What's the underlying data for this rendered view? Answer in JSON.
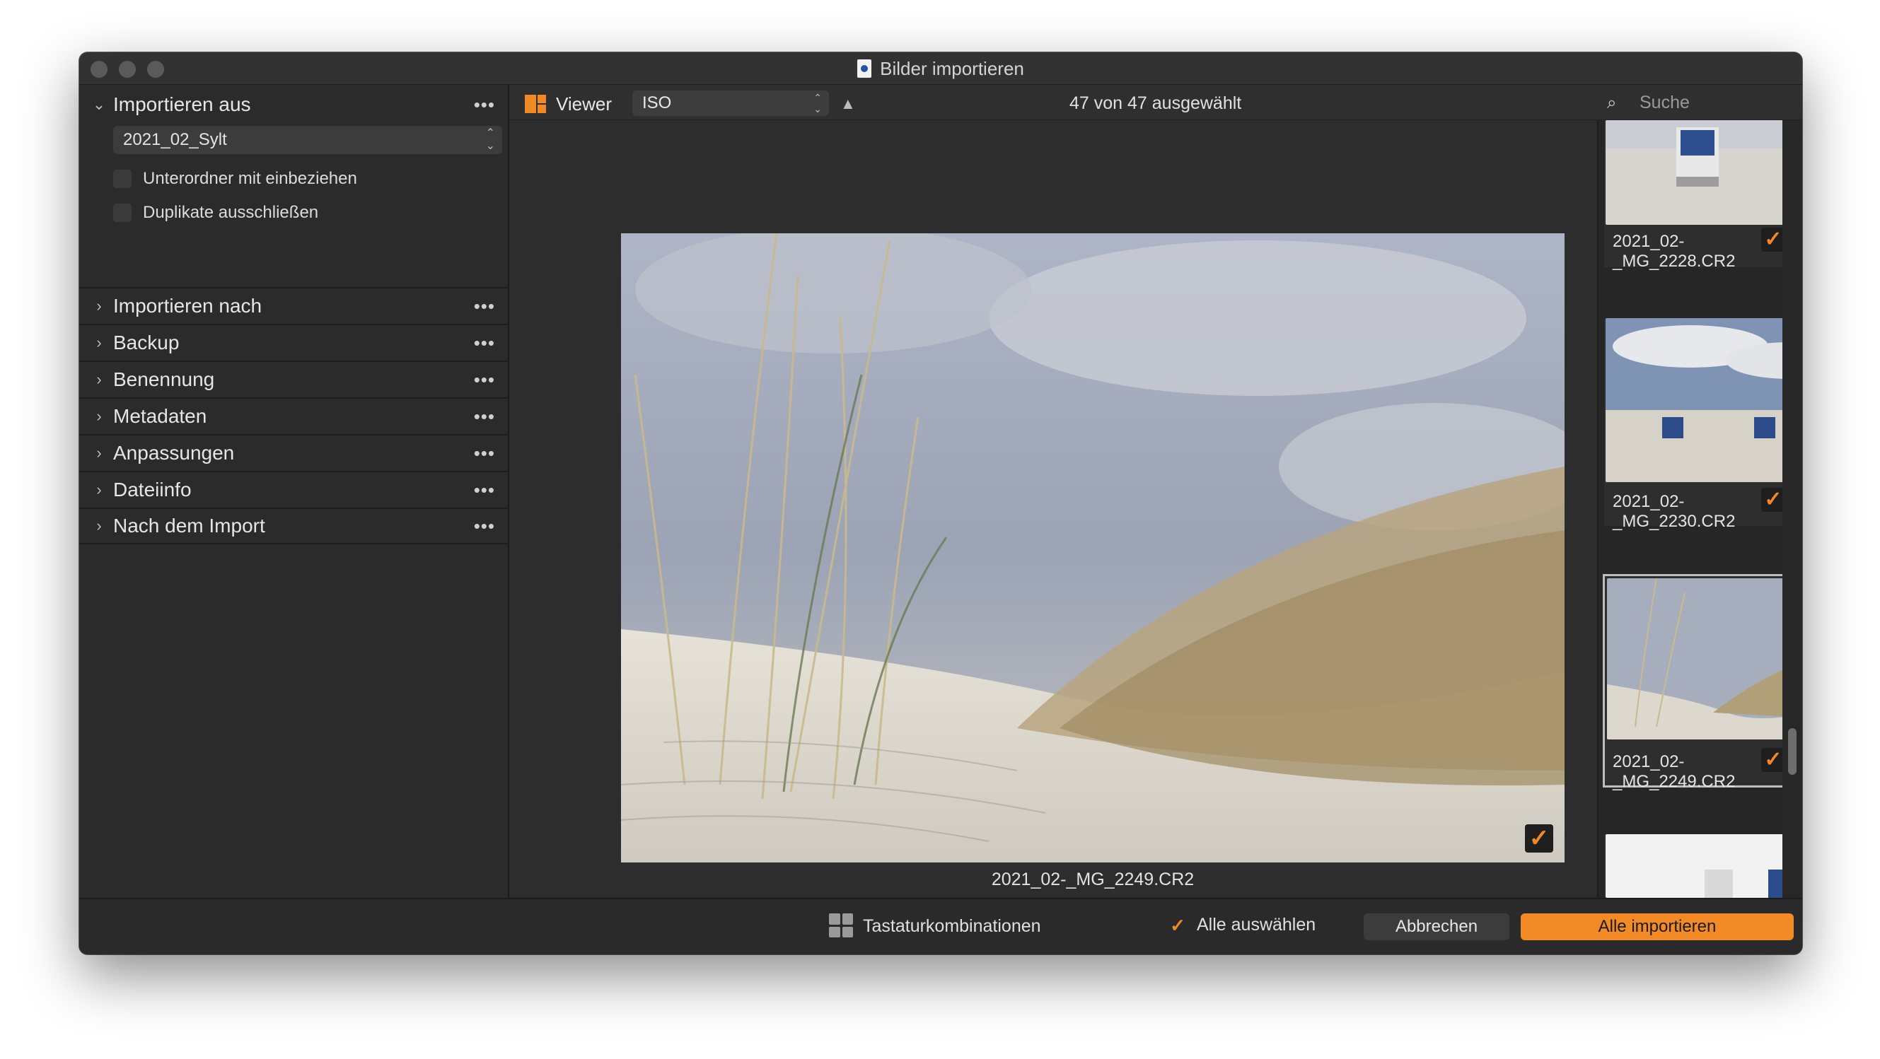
{
  "window": {
    "title": "Bilder importieren"
  },
  "left_panel": {
    "import_from": {
      "label": "Importieren aus",
      "folder": "2021_02_Sylt",
      "options": [
        {
          "label": "Unterordner mit einbeziehen",
          "checked": false
        },
        {
          "label": "Duplikate ausschließen",
          "checked": false
        }
      ]
    },
    "sections": [
      {
        "label": "Importieren nach"
      },
      {
        "label": "Backup"
      },
      {
        "label": "Benennung"
      },
      {
        "label": "Metadaten"
      },
      {
        "label": "Anpassungen"
      },
      {
        "label": "Dateiinfo"
      },
      {
        "label": "Nach dem Import"
      }
    ]
  },
  "toolbar": {
    "viewer_label": "Viewer",
    "sort_value": "ISO",
    "selection_count": "47 von 47 ausgewählt",
    "search_placeholder": "Suche"
  },
  "viewer": {
    "caption": "2021_02-_MG_2249.CR2",
    "selected": true
  },
  "thumbnails": [
    {
      "name": "2021_02-_MG_2228.CR2",
      "checked": true
    },
    {
      "name": "2021_02-_MG_2230.CR2",
      "checked": true
    },
    {
      "name": "2021_02-_MG_2249.CR2",
      "checked": true,
      "active": true
    },
    {
      "name": "",
      "checked": true
    }
  ],
  "bottom_bar": {
    "shortcuts_label": "Tastaturkombinationen",
    "select_all_label": "Alle auswählen",
    "select_all_checked": true,
    "cancel_label": "Abbrechen",
    "import_label": "Alle importieren"
  },
  "colors": {
    "accent": "#f28a25",
    "panel_bg": "#2b2b2b",
    "window_bg": "#2d2d2d"
  }
}
